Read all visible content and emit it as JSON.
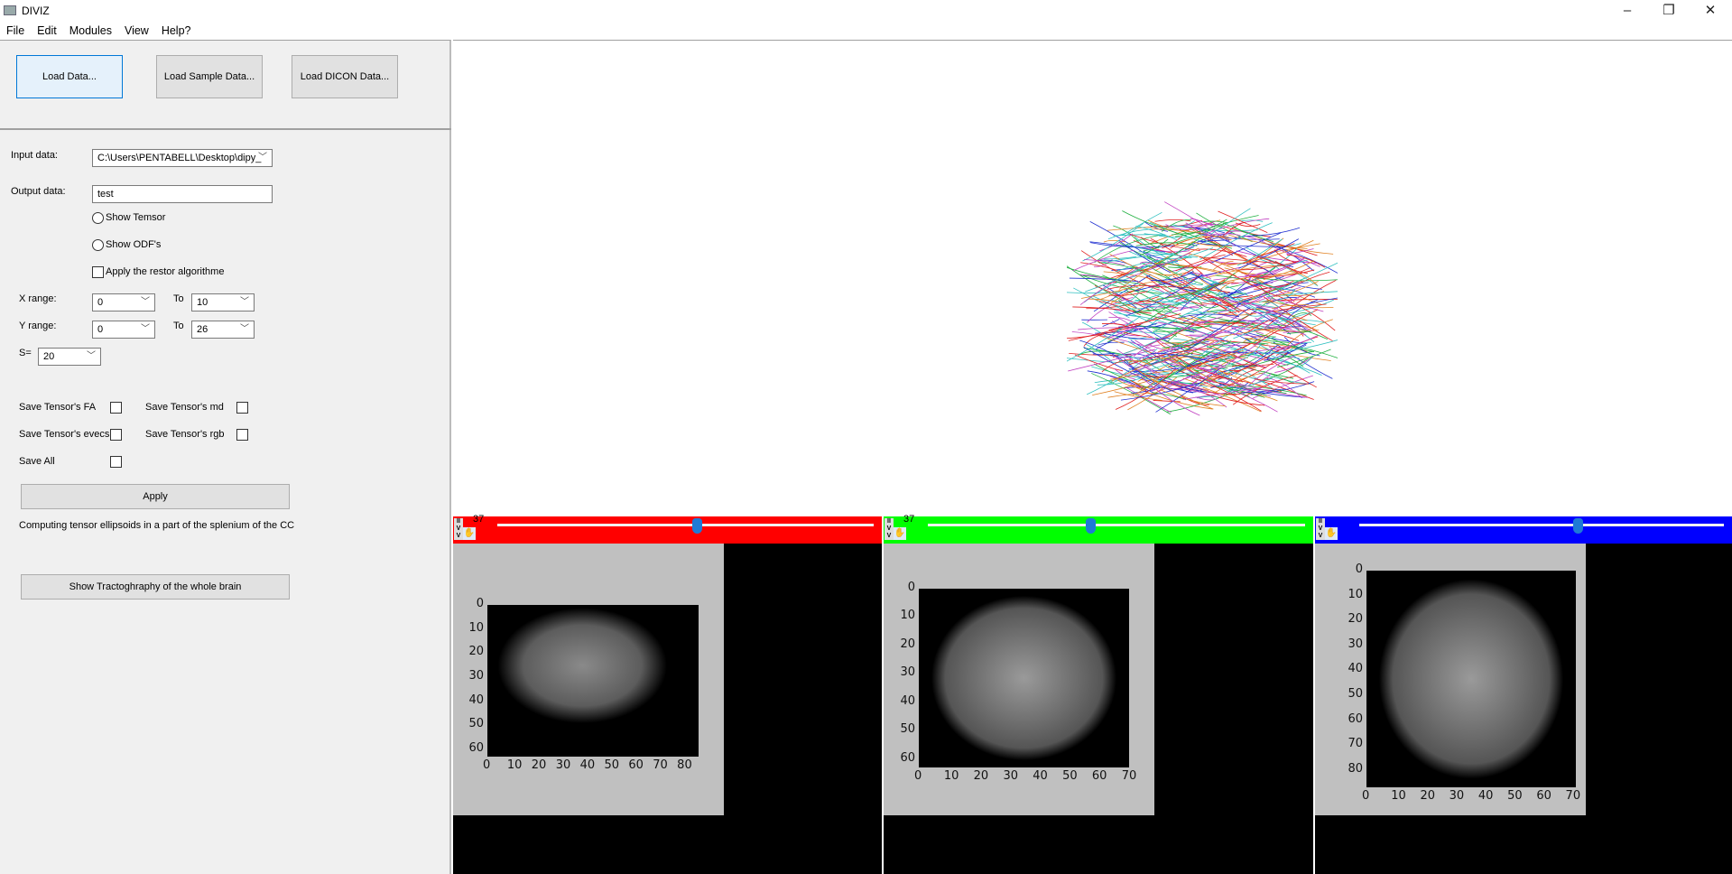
{
  "window": {
    "title": "DIVIZ",
    "controls": [
      "minimize",
      "restore",
      "close"
    ]
  },
  "menu": [
    "File",
    "Edit",
    "Modules",
    "View",
    "Help?"
  ],
  "toolbar": {
    "load_data": "Load Data...",
    "load_sample": "Load Sample Data...",
    "load_dicom": "Load DICON Data..."
  },
  "form": {
    "input_label": "Input data:",
    "input_value": "C:\\Users\\PENTABELL\\Desktop\\dipy_",
    "output_label": "Output data:",
    "output_value": "test",
    "show_tensor": "Show Temsor",
    "show_odf": "Show ODF's",
    "restor": "Apply the restor algorithme",
    "x_range_label": "X range:",
    "x_from": "0",
    "x_to": "10",
    "to_label": "To",
    "y_range_label": "Y range:",
    "y_from": "0",
    "y_to": "26",
    "s_label": "S=",
    "s_value": "20",
    "save_fa": "Save Tensor's FA",
    "save_md": "Save Tensor's md",
    "save_evecs": "Save Tensor's evecs",
    "save_rgb": "Save Tensor's rgb",
    "save_all": "Save All",
    "apply": "Apply",
    "status": "Computing tensor ellipsoids in a part of the splenium of the CC",
    "show_tract": "Show Tractoghraphy of the whole brain"
  },
  "slices": [
    {
      "color": "#ff0000",
      "value_label": "37",
      "slider_fraction": 0.53,
      "xticks": [
        "0",
        "10",
        "20",
        "30",
        "40",
        "50",
        "60",
        "70",
        "80"
      ],
      "yticks": [
        "0",
        "10",
        "20",
        "30",
        "40",
        "50",
        "60"
      ]
    },
    {
      "color": "#00ff00",
      "value_label": "37",
      "slider_fraction": 0.43,
      "xticks": [
        "0",
        "10",
        "20",
        "30",
        "40",
        "50",
        "60",
        "70"
      ],
      "yticks": [
        "0",
        "10",
        "20",
        "30",
        "40",
        "50",
        "60"
      ]
    },
    {
      "color": "#0000ff",
      "value_label": "",
      "slider_fraction": 0.6,
      "xticks": [
        "0",
        "10",
        "20",
        "30",
        "40",
        "50",
        "60",
        "70"
      ],
      "yticks": [
        "0",
        "10",
        "20",
        "30",
        "40",
        "50",
        "60",
        "70",
        "80"
      ]
    }
  ]
}
